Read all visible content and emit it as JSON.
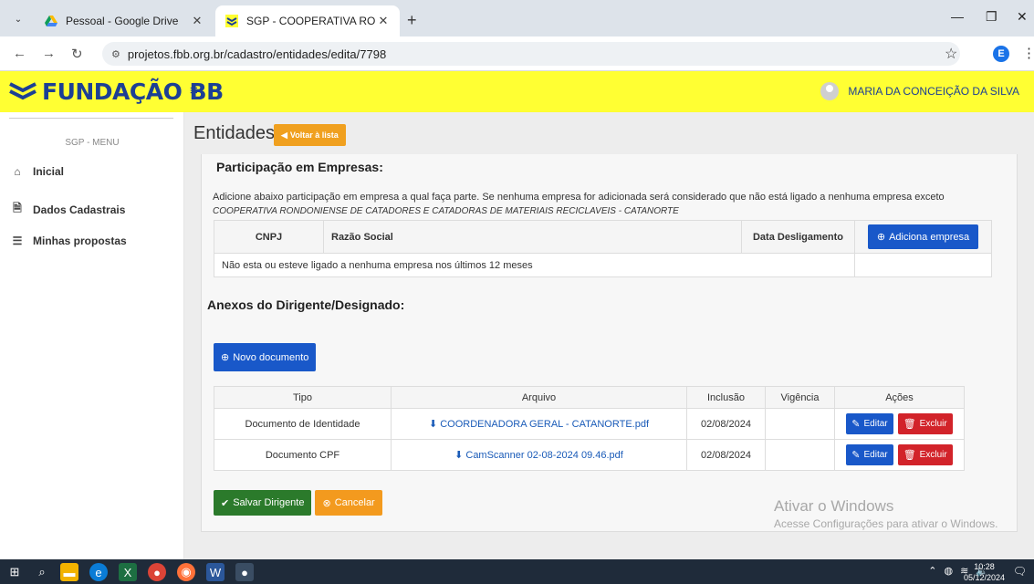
{
  "browser": {
    "tabs": [
      {
        "title": "Pessoal - Google Drive",
        "active": false
      },
      {
        "title": "SGP - COOPERATIVA RONDONI",
        "active": true
      }
    ],
    "url": "projetos.fbb.org.br/cadastro/entidades/edita/7798",
    "profile_initial": "E"
  },
  "header": {
    "logo_text": "FUNDAÇÃO BB",
    "user_name": "MARIA DA CONCEIÇÃO DA SILVA",
    "brand_color": "#ffff33"
  },
  "sidebar": {
    "title": "SGP - MENU",
    "items": [
      {
        "label": "Inicial",
        "icon": "home-icon"
      },
      {
        "label": "Dados Cadastrais",
        "icon": "document-icon"
      },
      {
        "label": "Minhas propostas",
        "icon": "list-icon"
      }
    ]
  },
  "page": {
    "title": "Entidades",
    "back_button": "Voltar à lista"
  },
  "empresas": {
    "heading": "Participação em Empresas:",
    "description": "Adicione abaixo participação em empresa a qual faça parte. Se nenhuma empresa for adicionada será considerado que não está ligado a nenhuma empresa exceto",
    "entity_name": "COOPERATIVA RONDONIENSE DE CATADORES E CATADORAS DE MATERIAIS RECICLAVEIS - CATANORTE",
    "columns": [
      "CNPJ",
      "Razão Social",
      "Data Desligamento"
    ],
    "add_button": "Adiciona empresa",
    "empty_message": "Não esta ou esteve ligado a nenhuma empresa nos últimos 12 meses"
  },
  "anexos": {
    "heading": "Anexos do Dirigente/Designado:",
    "new_button": "Novo documento",
    "columns": [
      "Tipo",
      "Arquivo",
      "Inclusão",
      "Vigência",
      "Ações"
    ],
    "rows": [
      {
        "tipo": "Documento de Identidade",
        "arquivo": "COORDENADORA GERAL - CATANORTE.pdf",
        "inclusao": "02/08/2024",
        "vigencia": ""
      },
      {
        "tipo": "Documento CPF",
        "arquivo": "CamScanner 02-08-2024 09.46.pdf",
        "inclusao": "02/08/2024",
        "vigencia": ""
      }
    ],
    "edit_label": "Editar",
    "delete_label": "Excluir"
  },
  "footer_buttons": {
    "save": "Salvar Dirigente",
    "cancel": "Cancelar"
  },
  "watermark": {
    "line1": "Ativar o Windows",
    "line2": "Acesse Configurações para ativar o Windows."
  },
  "taskbar": {
    "time": "10:28",
    "date": "05/12/2024"
  }
}
